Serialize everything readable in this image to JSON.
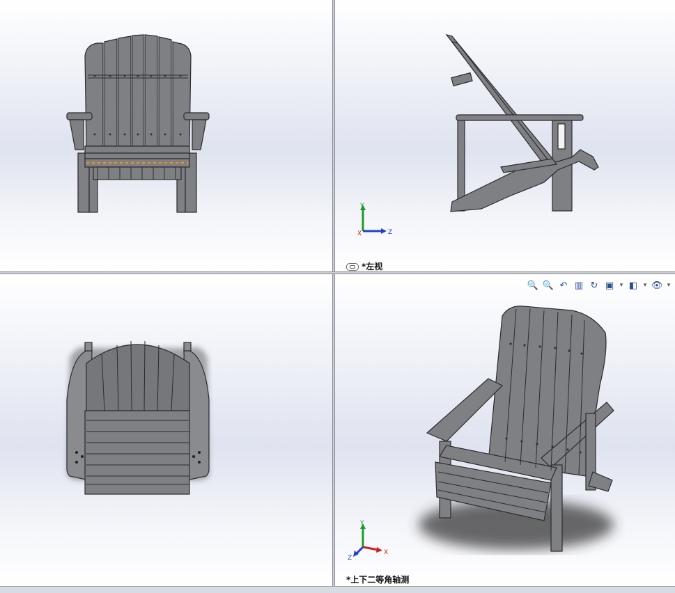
{
  "views": {
    "left": {
      "label": "*左视"
    },
    "iso": {
      "label": "*上下二等角轴测"
    }
  },
  "triad": {
    "x": "X",
    "y": "Y",
    "z": "Z"
  },
  "toolbar": {
    "zoom_fit": "🔍",
    "zoom_area": "🔍",
    "prev_view": "↶",
    "section": "▥",
    "dynamic_annotation": "↻",
    "view_orientation": "▣",
    "display_style": "◧",
    "hide_show": "👁",
    "dropdown": "▾"
  },
  "colors": {
    "part_fill": "#7f8084",
    "part_edge": "#2b2b2d",
    "selected_edge": "#f08c1a",
    "axis_x": "#d02020",
    "axis_y": "#1d9a2a",
    "axis_z": "#1f3fd0"
  }
}
